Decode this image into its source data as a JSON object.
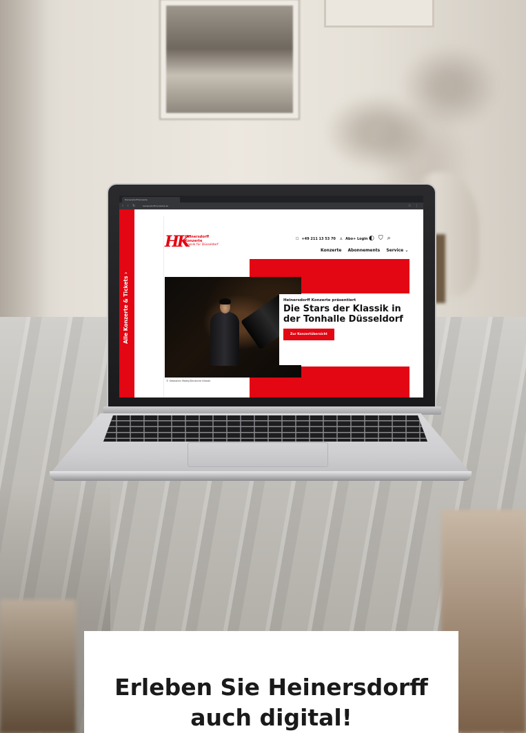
{
  "browser": {
    "tab_title": "Heinersdorff Konzerte",
    "url": "heinersdorff-konzerte.de"
  },
  "site": {
    "side_rail_label": "Alle Konzerte & Tickets ›",
    "logo_mark": "HK",
    "logo_name_line1": "Heinersdorff",
    "logo_name_line2": "Konzerte",
    "logo_tagline": "Klassik für Düsseldorf",
    "phone": "+49 211 13 53 70",
    "login": "Abo+ Login",
    "nav": [
      "Konzerte",
      "Abonnements",
      "Service ⌄"
    ],
    "hero_eyebrow": "Heinersdorff Konzerte präsentiert",
    "hero_title": "Die Stars der Klassik in der Tonhalle Düsseldorf",
    "hero_button": "Zur Konzertübersicht",
    "photo_credit": "© Sebastian Madej/Deutsche Klassik",
    "brand_color": "#e30613"
  },
  "caption": {
    "line1": "Erleben Sie Heinersdorff",
    "line2": "auch digital!"
  }
}
